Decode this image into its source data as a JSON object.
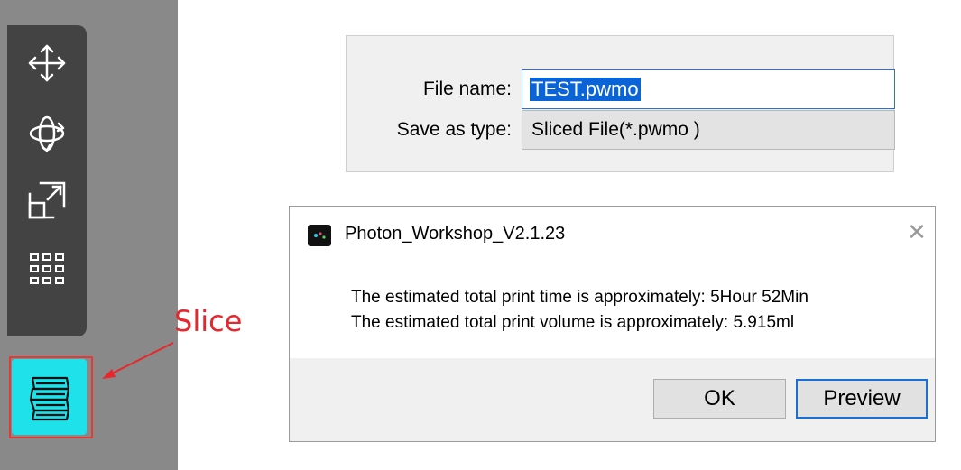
{
  "toolbar": {
    "tools": [
      {
        "icon": "move-icon"
      },
      {
        "icon": "rotate-icon"
      },
      {
        "icon": "scale-icon"
      },
      {
        "icon": "grid-icon"
      }
    ],
    "slice_icon": "layers-icon"
  },
  "annotation": {
    "label": "Slice",
    "color": "#e8262d"
  },
  "file_dialog": {
    "filename_label": "File name:",
    "filename_value": "TEST.pwmo",
    "savetype_label": "Save as type:",
    "savetype_value": "Sliced File(*.pwmo )"
  },
  "message_box": {
    "title": "Photon_Workshop_V2.1.23",
    "line1": "The estimated total print time is approximately: 5Hour 52Min",
    "line2": "The estimated total print volume is approximately: 5.915ml",
    "ok_label": "OK",
    "preview_label": "Preview"
  },
  "colors": {
    "accent_cyan": "#1fe1ea",
    "toolbar_bg": "#434343",
    "selection_blue": "#0a64d8"
  }
}
